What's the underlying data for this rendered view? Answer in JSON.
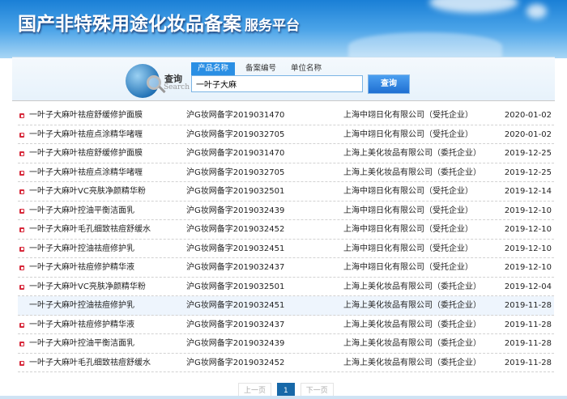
{
  "header": {
    "title": "国产非特殊用途化妆品备案",
    "subtitle": "服务平台"
  },
  "search": {
    "label": "查询",
    "label_en": "Search",
    "tabs": [
      "产品名称",
      "备案编号",
      "单位名称"
    ],
    "value": "一叶子大麻",
    "button": "查询"
  },
  "rows": [
    {
      "name": "一叶子大麻叶祛痘舒缓修护面膜",
      "code": "沪G妆网备字2019031470",
      "company": "上海中翊日化有限公司（受托企业）",
      "date": "2020-01-02"
    },
    {
      "name": "一叶子大麻叶祛痘点涂精华啫喱",
      "code": "沪G妆网备字2019032705",
      "company": "上海中翊日化有限公司（受托企业）",
      "date": "2020-01-02"
    },
    {
      "name": "一叶子大麻叶祛痘舒缓修护面膜",
      "code": "沪G妆网备字2019031470",
      "company": "上海上美化妆品有限公司（委托企业）",
      "date": "2019-12-25"
    },
    {
      "name": "一叶子大麻叶祛痘点涂精华啫喱",
      "code": "沪G妆网备字2019032705",
      "company": "上海上美化妆品有限公司（委托企业）",
      "date": "2019-12-25"
    },
    {
      "name": "一叶子大麻叶VC亮肤净颜精华粉",
      "code": "沪G妆网备字2019032501",
      "company": "上海中翊日化有限公司（受托企业）",
      "date": "2019-12-14"
    },
    {
      "name": "一叶子大麻叶控油平衡洁面乳",
      "code": "沪G妆网备字2019032439",
      "company": "上海中翊日化有限公司（受托企业）",
      "date": "2019-12-10"
    },
    {
      "name": "一叶子大麻叶毛孔细致祛痘舒缓水",
      "code": "沪G妆网备字2019032452",
      "company": "上海中翊日化有限公司（受托企业）",
      "date": "2019-12-10"
    },
    {
      "name": "一叶子大麻叶控油祛痘修护乳",
      "code": "沪G妆网备字2019032451",
      "company": "上海中翊日化有限公司（受托企业）",
      "date": "2019-12-10"
    },
    {
      "name": "一叶子大麻叶祛痘修护精华液",
      "code": "沪G妆网备字2019032437",
      "company": "上海中翊日化有限公司（受托企业）",
      "date": "2019-12-10"
    },
    {
      "name": "一叶子大麻叶VC亮肤净颜精华粉",
      "code": "沪G妆网备字2019032501",
      "company": "上海上美化妆品有限公司（委托企业）",
      "date": "2019-12-04"
    },
    {
      "name": "一叶子大麻叶控油祛痘修护乳",
      "code": "沪G妆网备字2019032451",
      "company": "上海上美化妆品有限公司（委托企业）",
      "date": "2019-11-28"
    },
    {
      "name": "一叶子大麻叶祛痘修护精华液",
      "code": "沪G妆网备字2019032437",
      "company": "上海上美化妆品有限公司（委托企业）",
      "date": "2019-11-28"
    },
    {
      "name": "一叶子大麻叶控油平衡洁面乳",
      "code": "沪G妆网备字2019032439",
      "company": "上海上美化妆品有限公司（委托企业）",
      "date": "2019-11-28"
    },
    {
      "name": "一叶子大麻叶毛孔细致祛痘舒缓水",
      "code": "沪G妆网备字2019032452",
      "company": "上海上美化妆品有限公司（委托企业）",
      "date": "2019-11-28"
    }
  ],
  "pager": {
    "prev": "上一页",
    "current": "1",
    "next": "下一页"
  }
}
